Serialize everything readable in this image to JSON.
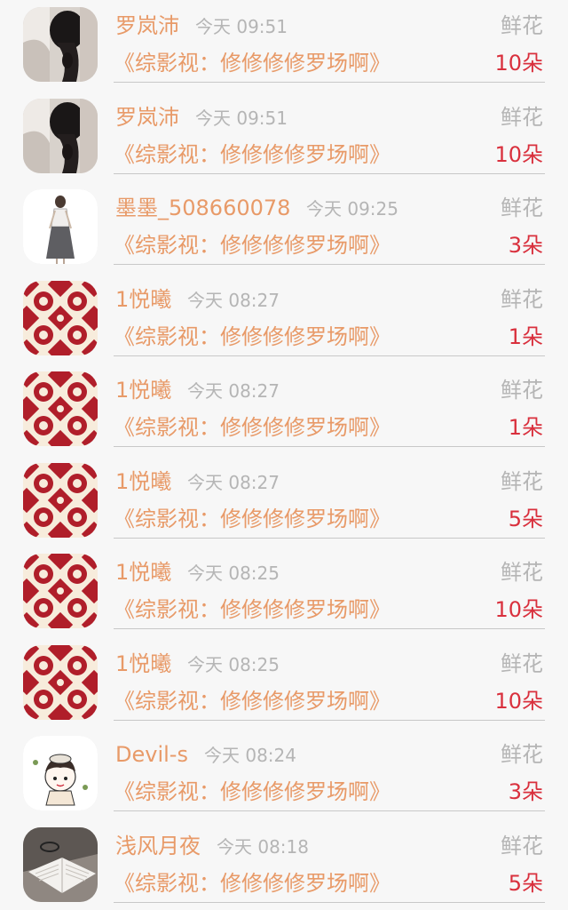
{
  "gifts": [
    {
      "user": "罗岚沛",
      "time": "今天 09:51",
      "gift_type": "鲜花",
      "book": "《综影视：修修修修罗场啊》",
      "amount": "10朵",
      "avatar": "photo-hair-avatar"
    },
    {
      "user": "罗岚沛",
      "time": "今天 09:51",
      "gift_type": "鲜花",
      "book": "《综影视：修修修修罗场啊》",
      "amount": "10朵",
      "avatar": "photo-hair-avatar"
    },
    {
      "user": "墨墨_508660078",
      "time": "今天 09:25",
      "gift_type": "鲜花",
      "book": "《综影视：修修修修罗场啊》",
      "amount": "3朵",
      "avatar": "figure-sketch-avatar"
    },
    {
      "user": "1悦曦",
      "time": "今天 08:27",
      "gift_type": "鲜花",
      "book": "《综影视：修修修修罗场啊》",
      "amount": "1朵",
      "avatar": "red-pattern-avatar"
    },
    {
      "user": "1悦曦",
      "time": "今天 08:27",
      "gift_type": "鲜花",
      "book": "《综影视：修修修修罗场啊》",
      "amount": "1朵",
      "avatar": "red-pattern-avatar"
    },
    {
      "user": "1悦曦",
      "time": "今天 08:27",
      "gift_type": "鲜花",
      "book": "《综影视：修修修修罗场啊》",
      "amount": "5朵",
      "avatar": "red-pattern-avatar"
    },
    {
      "user": "1悦曦",
      "time": "今天 08:25",
      "gift_type": "鲜花",
      "book": "《综影视：修修修修罗场啊》",
      "amount": "10朵",
      "avatar": "red-pattern-avatar"
    },
    {
      "user": "1悦曦",
      "time": "今天 08:25",
      "gift_type": "鲜花",
      "book": "《综影视：修修修修罗场啊》",
      "amount": "10朵",
      "avatar": "red-pattern-avatar"
    },
    {
      "user": "Devil-s",
      "time": "今天 08:24",
      "gift_type": "鲜花",
      "book": "《综影视：修修修修罗场啊》",
      "amount": "3朵",
      "avatar": "cartoon-girl-avatar"
    },
    {
      "user": "浅风月夜",
      "time": "今天 08:18",
      "gift_type": "鲜花",
      "book": "《综影视：修修修修罗场啊》",
      "amount": "5朵",
      "avatar": "book-photo-avatar"
    }
  ],
  "colors": {
    "name": "#e89a68",
    "book": "#e89a68",
    "meta": "#b5b5b5",
    "amount": "#d9303d",
    "background": "#f7f7f7"
  }
}
